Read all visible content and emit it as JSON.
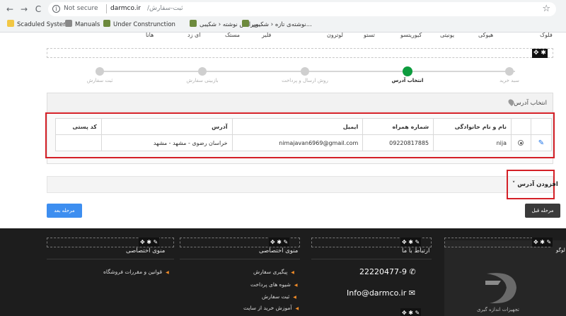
{
  "browser": {
    "back": "←",
    "forward": "→",
    "reload": "C",
    "info": "i",
    "security": "Not secure",
    "host": "darmco.ir",
    "path": "/ثبت-سفارش",
    "star": "☆",
    "bookmarks": [
      {
        "label": "Scaduled System",
        "icon": "folder-icon"
      },
      {
        "label": "Manuals",
        "icon": "globe-icon"
      },
      {
        "label": "Under Construnction",
        "icon": "leaf-icon"
      },
      {
        "label": "ویرایش نوشته ‹ شکیبی...",
        "icon": "leaf-icon"
      },
      {
        "label": "نوشته‌ی تازه ‹ شکیبی...",
        "icon": "leaf-icon"
      }
    ]
  },
  "categories": {
    "row1": [
      "فلوک",
      "هیوکی",
      "یونیتی",
      "کیوریتسو",
      "تستو",
      "لوترون",
      "فلیر",
      "مستک",
      "ای زد",
      "هانا"
    ]
  },
  "editor_tools": "✥ ✱",
  "steps": [
    {
      "label": "سبد خرید",
      "active": false
    },
    {
      "label": "انتخاب آدرس",
      "active": true
    },
    {
      "label": "روش ارسال و پرداخت",
      "active": false
    },
    {
      "label": "بازبینی سفارش",
      "active": false
    },
    {
      "label": "ثبت سفارش",
      "active": false
    }
  ],
  "address_panel": {
    "title": "انتخاب آدرس",
    "columns": [
      "نام و نام خانوادگی",
      "شماره همراه",
      "ایمیل",
      "آدرس",
      "کد پستی"
    ],
    "rows": [
      {
        "name": "nija",
        "mobile": "09220817885",
        "email": "nimajavan6969@gmail.com",
        "address": "خراسان رضوی - مشهد - مشهد",
        "postal": ""
      }
    ]
  },
  "add_address": {
    "label": "افزودن آدرس",
    "chevron": "˅"
  },
  "buttons": {
    "next": "مرحله بعد",
    "prev": "مرحله قبل"
  },
  "footer": {
    "col_contact": {
      "title": "ارتباط با ما",
      "phone": "22220477-9",
      "email": "Info@darmco.ir"
    },
    "col_menu1": {
      "title": "منوی اختصاصی",
      "links": [
        "پیگیری سفارش",
        "شیوه های پرداخت",
        "ثبت سفارش",
        "آموزش خرید از سایت"
      ]
    },
    "col_menu2": {
      "title": "منوی اختصاصی",
      "links": [
        "قوانین و مقررات فروشگاه"
      ]
    },
    "logo_text": "تجهیزات اندازه گیری",
    "logo_label": "لوگو"
  }
}
